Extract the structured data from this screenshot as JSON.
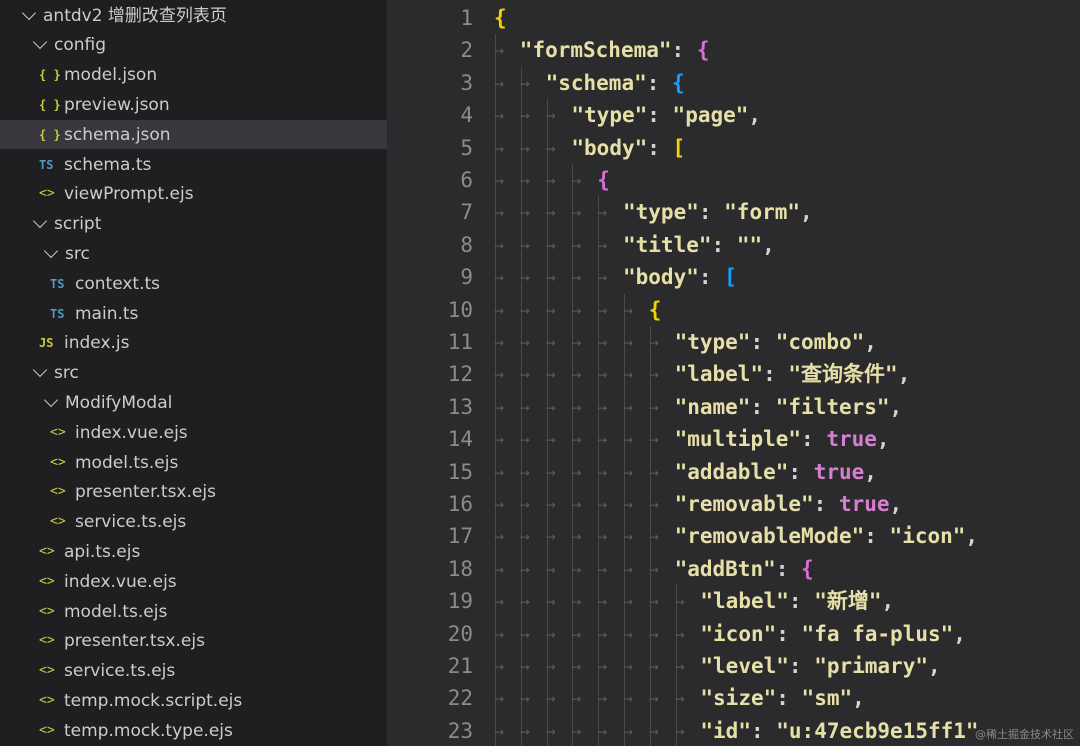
{
  "explorer": {
    "items": [
      {
        "label": "antdv2 增删改查列表页",
        "kind": "folder",
        "depth": 0,
        "icon": "chevron-down-icon"
      },
      {
        "label": "config",
        "kind": "folder",
        "depth": 1,
        "icon": "chevron-down-icon"
      },
      {
        "label": "model.json",
        "kind": "json",
        "depth": 2,
        "icon": "json-file-icon",
        "glyph": "{ }"
      },
      {
        "label": "preview.json",
        "kind": "json",
        "depth": 2,
        "icon": "json-file-icon",
        "glyph": "{ }"
      },
      {
        "label": "schema.json",
        "kind": "json",
        "depth": 2,
        "icon": "json-file-icon",
        "glyph": "{ }",
        "selected": true
      },
      {
        "label": "schema.ts",
        "kind": "ts",
        "depth": 2,
        "icon": "typescript-file-icon",
        "glyph": "TS"
      },
      {
        "label": "viewPrompt.ejs",
        "kind": "ejs",
        "depth": 2,
        "icon": "code-file-icon",
        "glyph": "<>"
      },
      {
        "label": "script",
        "kind": "folder",
        "depth": 1,
        "icon": "chevron-down-icon"
      },
      {
        "label": "src",
        "kind": "folder",
        "depth": 2,
        "icon": "chevron-down-icon"
      },
      {
        "label": "context.ts",
        "kind": "ts",
        "depth": 3,
        "icon": "typescript-file-icon",
        "glyph": "TS"
      },
      {
        "label": "main.ts",
        "kind": "ts",
        "depth": 3,
        "icon": "typescript-file-icon",
        "glyph": "TS"
      },
      {
        "label": "index.js",
        "kind": "js",
        "depth": 2,
        "icon": "javascript-file-icon",
        "glyph": "JS"
      },
      {
        "label": "src",
        "kind": "folder",
        "depth": 1,
        "icon": "chevron-down-icon"
      },
      {
        "label": "ModifyModal",
        "kind": "folder",
        "depth": 2,
        "icon": "chevron-down-icon"
      },
      {
        "label": "index.vue.ejs",
        "kind": "ejs",
        "depth": 3,
        "icon": "code-file-icon",
        "glyph": "<>"
      },
      {
        "label": "model.ts.ejs",
        "kind": "ejs",
        "depth": 3,
        "icon": "code-file-icon",
        "glyph": "<>"
      },
      {
        "label": "presenter.tsx.ejs",
        "kind": "ejs",
        "depth": 3,
        "icon": "code-file-icon",
        "glyph": "<>"
      },
      {
        "label": "service.ts.ejs",
        "kind": "ejs",
        "depth": 3,
        "icon": "code-file-icon",
        "glyph": "<>"
      },
      {
        "label": "api.ts.ejs",
        "kind": "ejs",
        "depth": 2,
        "icon": "code-file-icon",
        "glyph": "<>"
      },
      {
        "label": "index.vue.ejs",
        "kind": "ejs",
        "depth": 2,
        "icon": "code-file-icon",
        "glyph": "<>"
      },
      {
        "label": "model.ts.ejs",
        "kind": "ejs",
        "depth": 2,
        "icon": "code-file-icon",
        "glyph": "<>"
      },
      {
        "label": "presenter.tsx.ejs",
        "kind": "ejs",
        "depth": 2,
        "icon": "code-file-icon",
        "glyph": "<>"
      },
      {
        "label": "service.ts.ejs",
        "kind": "ejs",
        "depth": 2,
        "icon": "code-file-icon",
        "glyph": "<>"
      },
      {
        "label": "temp.mock.script.ejs",
        "kind": "ejs",
        "depth": 2,
        "icon": "code-file-icon",
        "glyph": "<>"
      },
      {
        "label": "temp.mock.type.ejs",
        "kind": "ejs",
        "depth": 2,
        "icon": "code-file-icon",
        "glyph": "<>"
      }
    ]
  },
  "editor": {
    "lines": [
      {
        "n": "1",
        "indent": 0,
        "tokens": [
          [
            "b1",
            "{"
          ]
        ]
      },
      {
        "n": "2",
        "indent": 1,
        "tokens": [
          [
            "key",
            "\"formSchema\""
          ],
          [
            "punc",
            ": "
          ],
          [
            "b2",
            "{"
          ]
        ]
      },
      {
        "n": "3",
        "indent": 2,
        "tokens": [
          [
            "key",
            "\"schema\""
          ],
          [
            "punc",
            ": "
          ],
          [
            "b3",
            "{"
          ]
        ]
      },
      {
        "n": "4",
        "indent": 3,
        "tokens": [
          [
            "key",
            "\"type\""
          ],
          [
            "punc",
            ": "
          ],
          [
            "str",
            "\"page\""
          ],
          [
            "punc",
            ","
          ]
        ]
      },
      {
        "n": "5",
        "indent": 3,
        "tokens": [
          [
            "key",
            "\"body\""
          ],
          [
            "punc",
            ": "
          ],
          [
            "b1",
            "["
          ]
        ]
      },
      {
        "n": "6",
        "indent": 4,
        "tokens": [
          [
            "b2",
            "{"
          ]
        ]
      },
      {
        "n": "7",
        "indent": 5,
        "tokens": [
          [
            "key",
            "\"type\""
          ],
          [
            "punc",
            ": "
          ],
          [
            "str",
            "\"form\""
          ],
          [
            "punc",
            ","
          ]
        ]
      },
      {
        "n": "8",
        "indent": 5,
        "tokens": [
          [
            "key",
            "\"title\""
          ],
          [
            "punc",
            ": "
          ],
          [
            "str",
            "\"\""
          ],
          [
            "punc",
            ","
          ]
        ]
      },
      {
        "n": "9",
        "indent": 5,
        "tokens": [
          [
            "key",
            "\"body\""
          ],
          [
            "punc",
            ": "
          ],
          [
            "b3",
            "["
          ]
        ]
      },
      {
        "n": "10",
        "indent": 6,
        "tokens": [
          [
            "b1",
            "{"
          ]
        ]
      },
      {
        "n": "11",
        "indent": 7,
        "tokens": [
          [
            "key",
            "\"type\""
          ],
          [
            "punc",
            ": "
          ],
          [
            "str",
            "\"combo\""
          ],
          [
            "punc",
            ","
          ]
        ]
      },
      {
        "n": "12",
        "indent": 7,
        "tokens": [
          [
            "key",
            "\"label\""
          ],
          [
            "punc",
            ": "
          ],
          [
            "str",
            "\"查询条件\""
          ],
          [
            "punc",
            ","
          ]
        ]
      },
      {
        "n": "13",
        "indent": 7,
        "tokens": [
          [
            "key",
            "\"name\""
          ],
          [
            "punc",
            ": "
          ],
          [
            "str",
            "\"filters\""
          ],
          [
            "punc",
            ","
          ]
        ]
      },
      {
        "n": "14",
        "indent": 7,
        "tokens": [
          [
            "key",
            "\"multiple\""
          ],
          [
            "punc",
            ": "
          ],
          [
            "bool",
            "true"
          ],
          [
            "punc",
            ","
          ]
        ]
      },
      {
        "n": "15",
        "indent": 7,
        "tokens": [
          [
            "key",
            "\"addable\""
          ],
          [
            "punc",
            ": "
          ],
          [
            "bool",
            "true"
          ],
          [
            "punc",
            ","
          ]
        ]
      },
      {
        "n": "16",
        "indent": 7,
        "tokens": [
          [
            "key",
            "\"removable\""
          ],
          [
            "punc",
            ": "
          ],
          [
            "bool",
            "true"
          ],
          [
            "punc",
            ","
          ]
        ]
      },
      {
        "n": "17",
        "indent": 7,
        "tokens": [
          [
            "key",
            "\"removableMode\""
          ],
          [
            "punc",
            ": "
          ],
          [
            "str",
            "\"icon\""
          ],
          [
            "punc",
            ","
          ]
        ]
      },
      {
        "n": "18",
        "indent": 7,
        "tokens": [
          [
            "key",
            "\"addBtn\""
          ],
          [
            "punc",
            ": "
          ],
          [
            "b2",
            "{"
          ]
        ]
      },
      {
        "n": "19",
        "indent": 8,
        "tokens": [
          [
            "key",
            "\"label\""
          ],
          [
            "punc",
            ": "
          ],
          [
            "str",
            "\"新增\""
          ],
          [
            "punc",
            ","
          ]
        ]
      },
      {
        "n": "20",
        "indent": 8,
        "tokens": [
          [
            "key",
            "\"icon\""
          ],
          [
            "punc",
            ": "
          ],
          [
            "str",
            "\"fa fa-plus\""
          ],
          [
            "punc",
            ","
          ]
        ]
      },
      {
        "n": "21",
        "indent": 8,
        "tokens": [
          [
            "key",
            "\"level\""
          ],
          [
            "punc",
            ": "
          ],
          [
            "str",
            "\"primary\""
          ],
          [
            "punc",
            ","
          ]
        ]
      },
      {
        "n": "22",
        "indent": 8,
        "tokens": [
          [
            "key",
            "\"size\""
          ],
          [
            "punc",
            ": "
          ],
          [
            "str",
            "\"sm\""
          ],
          [
            "punc",
            ","
          ]
        ]
      },
      {
        "n": "23",
        "indent": 8,
        "tokens": [
          [
            "key",
            "\"id\""
          ],
          [
            "punc",
            ": "
          ],
          [
            "str",
            "\"u:47ecb9e15ff1\""
          ]
        ]
      }
    ]
  },
  "watermark": "@稀土掘金技术社区",
  "colors": {
    "sidebar_bg": "#1f1f21",
    "editor_bg": "#2b2b2d",
    "selected_row": "#37373d",
    "bracket_1": "#f1d700",
    "bracket_2": "#da70d6",
    "bracket_3": "#179fff",
    "string": "#e6e0a8",
    "boolean": "#d67fd0"
  }
}
